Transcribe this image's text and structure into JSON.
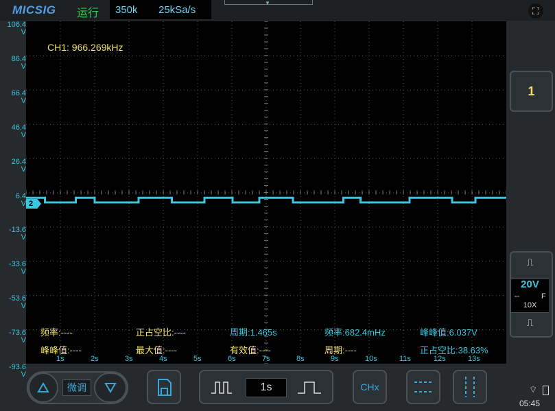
{
  "header": {
    "logo": "MICSIG",
    "run_status": "运行",
    "memory_depth": "350k",
    "sample_rate": "25kSa/s"
  },
  "screen": {
    "ch1_frequency": "CH1: 966.269kHz",
    "y_labels": [
      {
        "value": "106.4",
        "unit": "V"
      },
      {
        "value": "86.4",
        "unit": "V"
      },
      {
        "value": "66.4",
        "unit": "V"
      },
      {
        "value": "46.4",
        "unit": "V"
      },
      {
        "value": "26.4",
        "unit": "V"
      },
      {
        "value": "6.4",
        "unit": "V"
      },
      {
        "value": "-13.6",
        "unit": "V"
      },
      {
        "value": "-33.6",
        "unit": "V"
      },
      {
        "value": "-53.6",
        "unit": "V"
      },
      {
        "value": "-73.6",
        "unit": "V"
      },
      {
        "value": "-93.6",
        "unit": "V"
      }
    ],
    "x_labels": [
      "1s",
      "2s",
      "3s",
      "4s",
      "5s",
      "6s",
      "7s",
      "8s",
      "9s",
      "10s",
      "11s",
      "12s",
      "13s"
    ],
    "ch2_marker": "2",
    "measurements_row1": [
      {
        "label": "频率:----",
        "color": "yellow"
      },
      {
        "label": "正占空比:----",
        "color": "yellow"
      },
      {
        "label": "周期:1.465s",
        "color": "cyan"
      },
      {
        "label": "频率:682.4mHz",
        "color": "cyan"
      },
      {
        "label": "峰峰值:6.037V",
        "color": "cyan"
      }
    ],
    "measurements_row2": [
      {
        "label": "峰峰值:----",
        "color": "yellow"
      },
      {
        "label": "最大值:----",
        "color": "yellow"
      },
      {
        "label": "有效值:----",
        "color": "yellow"
      },
      {
        "label": "周期:----",
        "color": "yellow"
      },
      {
        "label": "正占空比:38.63%",
        "color": "cyan"
      }
    ]
  },
  "chart_data": {
    "type": "line",
    "title": "",
    "xlabel": "",
    "ylabel": "",
    "x_unit": "s",
    "y_unit": "V",
    "xlim": [
      0,
      14
    ],
    "ylim": [
      -103.6,
      116.4
    ],
    "series": [
      {
        "name": "CH2",
        "color": "#39c6df",
        "x": [
          0,
          0.55,
          0.55,
          1.45,
          1.45,
          2.0,
          2.0,
          3.28,
          3.28,
          4.25,
          4.25,
          5.2,
          5.2,
          6.02,
          6.02,
          6.8,
          6.8,
          7.78,
          7.78,
          9.25,
          9.25,
          9.75,
          9.75,
          11.18,
          11.18,
          12.42,
          12.42,
          13.1,
          13.1,
          14
        ],
        "y": [
          3.0,
          3.0,
          0.0,
          0.0,
          3.0,
          3.0,
          0.0,
          0.0,
          3.0,
          3.0,
          0.0,
          0.0,
          3.0,
          3.0,
          0.0,
          0.0,
          3.0,
          3.0,
          0.0,
          0.0,
          3.0,
          3.0,
          0.0,
          0.0,
          3.0,
          3.0,
          0.0,
          0.0,
          3.0,
          3.0
        ]
      }
    ],
    "grid": true,
    "theme": {
      "background": "#000000",
      "grid": "#5a5a5a",
      "axis_label": "#39c6df"
    }
  },
  "right_panel": {
    "ch1_button": "1",
    "ch2_volts_div": "20V",
    "ch2_coupling": "F",
    "ch2_probe": "10X"
  },
  "bottom_bar": {
    "fine_adjust": "微调",
    "timebase": "1s",
    "chx_label": "CHx"
  },
  "status": {
    "time": "05:45"
  }
}
